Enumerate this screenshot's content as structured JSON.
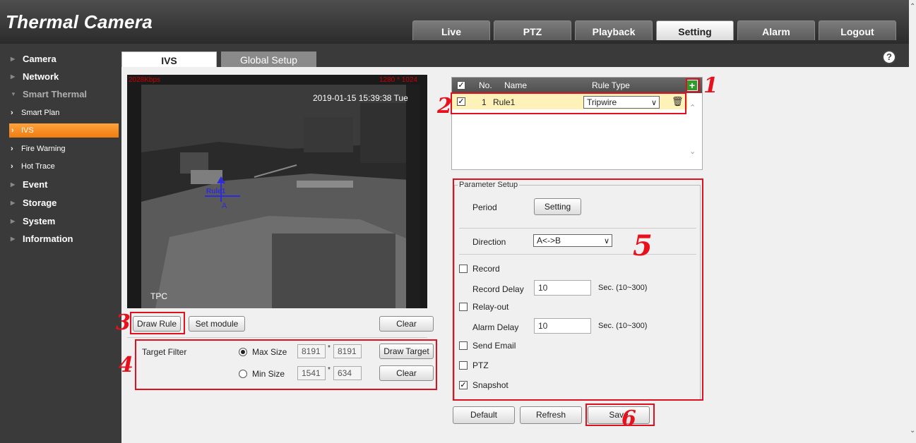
{
  "app": {
    "title": "Thermal Camera"
  },
  "nav": {
    "tabs": [
      "Live",
      "PTZ",
      "Playback",
      "Setting",
      "Alarm",
      "Logout"
    ],
    "active": "Setting"
  },
  "sidebar": {
    "items": [
      {
        "label": "Camera"
      },
      {
        "label": "Network"
      },
      {
        "label": "Smart Thermal"
      },
      {
        "label": "Smart Plan"
      },
      {
        "label": "IVS"
      },
      {
        "label": "Fire Warning"
      },
      {
        "label": "Hot Trace"
      },
      {
        "label": "Event"
      },
      {
        "label": "Storage"
      },
      {
        "label": "System"
      },
      {
        "label": "Information"
      }
    ]
  },
  "subtabs": [
    "IVS",
    "Global Setup"
  ],
  "help": "?",
  "video": {
    "bitrate": "2028Kbps",
    "resolution": "1280 * 1024",
    "timestamp": "2019-01-15 15:39:38 Tue",
    "osd_label": "TPC",
    "rule_label": "Rule1",
    "point_label": "A"
  },
  "video_buttons": {
    "draw_rule": "Draw Rule",
    "set_module": "Set module",
    "clear": "Clear"
  },
  "target_filter": {
    "label": "Target Filter",
    "max_size": {
      "label": "Max Size",
      "w": "8191",
      "h": "8191",
      "selected": true
    },
    "min_size": {
      "label": "Min Size",
      "w": "1541",
      "h": "634",
      "selected": false
    },
    "sep": "*",
    "draw_target": "Draw Target",
    "clear": "Clear"
  },
  "rules_table": {
    "headers": {
      "no": "No.",
      "name": "Name",
      "rule_type": "Rule Type"
    },
    "rows": [
      {
        "checked": true,
        "no": "1",
        "name": "Rule1",
        "rule_type": "Tripwire"
      }
    ]
  },
  "parameter_setup": {
    "legend": "Parameter Setup",
    "period_label": "Period",
    "setting_button": "Setting",
    "direction_label": "Direction",
    "direction_value": "A<->B",
    "record": {
      "label": "Record",
      "checked": false
    },
    "record_delay": {
      "label": "Record Delay",
      "value": "10",
      "unit": "Sec. (10~300)"
    },
    "relay_out": {
      "label": "Relay-out",
      "checked": false
    },
    "alarm_delay": {
      "label": "Alarm Delay",
      "value": "10",
      "unit": "Sec. (10~300)"
    },
    "send_email": {
      "label": "Send Email",
      "checked": false
    },
    "ptz": {
      "label": "PTZ",
      "checked": false
    },
    "snapshot": {
      "label": "Snapshot",
      "checked": true
    }
  },
  "footer_buttons": {
    "default": "Default",
    "refresh": "Refresh",
    "save": "Save"
  },
  "annotations": [
    "1",
    "2",
    "3",
    "4",
    "5",
    "6"
  ],
  "colors": {
    "accent": "#f58a1f",
    "annotation": "#e01020",
    "header": "#3a3a3a"
  }
}
